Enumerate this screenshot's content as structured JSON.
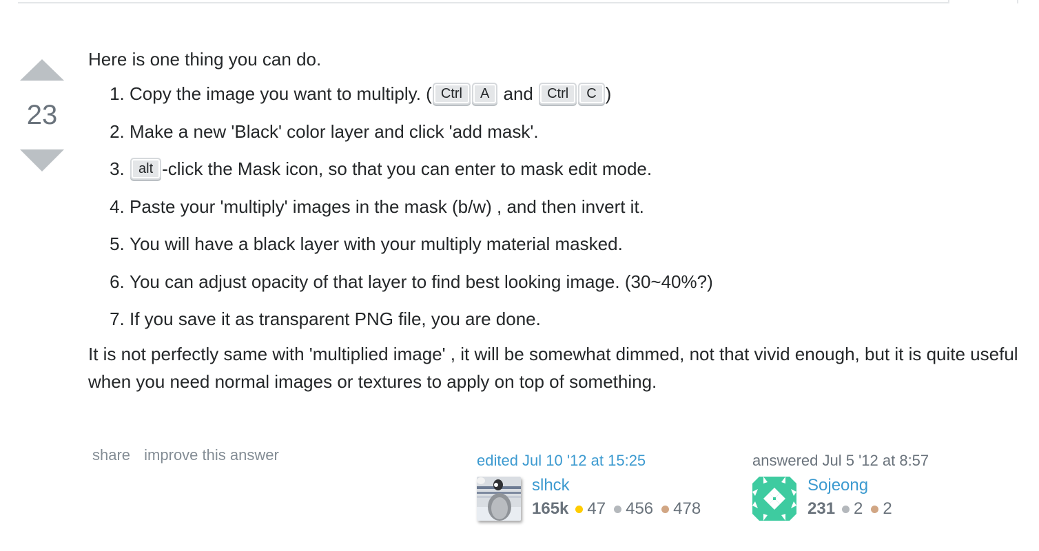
{
  "vote": {
    "count": "23",
    "up_icon": "upvote-arrow-icon",
    "down_icon": "downvote-arrow-icon"
  },
  "post": {
    "intro": "Here is one thing you can do.",
    "steps": [
      {
        "parts": [
          {
            "type": "text",
            "value": "Copy the image you want to multiply. ("
          },
          {
            "type": "kbd",
            "value": "Ctrl"
          },
          {
            "type": "kbd",
            "value": "A"
          },
          {
            "type": "text",
            "value": " and "
          },
          {
            "type": "kbd",
            "value": "Ctrl"
          },
          {
            "type": "kbd",
            "value": "C"
          },
          {
            "type": "text",
            "value": ")"
          }
        ]
      },
      {
        "parts": [
          {
            "type": "text",
            "value": "Make a new 'Black' color layer and click 'add mask'."
          }
        ]
      },
      {
        "parts": [
          {
            "type": "kbd",
            "value": "alt"
          },
          {
            "type": "text",
            "value": "-click the Mask icon, so that you can enter to mask edit mode."
          }
        ]
      },
      {
        "parts": [
          {
            "type": "text",
            "value": "Paste your 'multiply' images in the mask (b/w) , and then invert it."
          }
        ]
      },
      {
        "parts": [
          {
            "type": "text",
            "value": "You will have a black layer with your multiply material masked."
          }
        ]
      },
      {
        "parts": [
          {
            "type": "text",
            "value": "You can adjust opacity of that layer to find best looking image. (30~40%?)"
          }
        ]
      },
      {
        "parts": [
          {
            "type": "text",
            "value": "If you save it as transparent PNG file, you are done."
          }
        ]
      }
    ],
    "outro": "It is not perfectly same with 'multiplied image' , it will be somewhat dimmed, not that vivid enough, but it is quite useful when you need normal images or textures to apply on top of something."
  },
  "menu": {
    "share": "share",
    "improve": "improve this answer"
  },
  "editor": {
    "action": "edited Jul 10 '12 at 15:25",
    "name": "slhck",
    "reputation": "165k",
    "gold": "47",
    "silver": "456",
    "bronze": "478",
    "avatar_icon": "penguin-avatar-icon"
  },
  "owner": {
    "action": "answered Jul 5 '12 at 8:57",
    "name": "Sojeong",
    "reputation": "231",
    "silver": "2",
    "bronze": "2",
    "avatar_icon": "identicon-avatar-icon"
  },
  "colors": {
    "link": "#3c9ad0",
    "vote_arrow": "#bbc0c4",
    "muted": "#848d95",
    "identicon": "#3ecba0",
    "gold": "#ffcc01",
    "silver": "#b4b8bc",
    "bronze": "#d1a684"
  }
}
